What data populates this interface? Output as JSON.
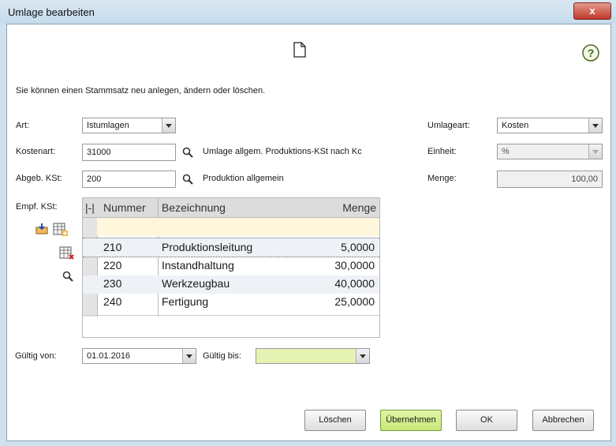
{
  "window": {
    "title": "Umlage bearbeiten",
    "close_glyph": "x"
  },
  "intro_text": "Sie können einen Stammsatz neu anlegen, ändern oder löschen.",
  "icons": {
    "new_record": "document-icon",
    "help": "help-icon"
  },
  "form": {
    "art": {
      "label": "Art:",
      "value": "Istumlagen"
    },
    "kostenart": {
      "label": "Kostenart:",
      "value": "31000",
      "description": "Umlage allgem. Produktions-KSt nach Kc"
    },
    "abgeb_kst": {
      "label": "Abgeb. KSt:",
      "value": "200",
      "description": "Produktion allgemein"
    },
    "empf_kst": {
      "label": "Empf. KSt:"
    },
    "umlageart": {
      "label": "Umlageart:",
      "value": "Kosten"
    },
    "einheit": {
      "label": "Einheit:",
      "value": "%"
    },
    "menge": {
      "label": "Menge:",
      "value": "100,00"
    },
    "gueltig_von": {
      "label": "Gültig von:",
      "value": "01.01.2016"
    },
    "gueltig_bis": {
      "label": "Gültig bis:",
      "value": ""
    }
  },
  "grid": {
    "columns": {
      "marker": "|-|",
      "nummer": "Nummer",
      "bezeichnung": "Bezeichnung",
      "menge": "Menge"
    },
    "rows": [
      {
        "nummer": "210",
        "bezeichnung": "Produktionsleitung",
        "menge": "5,0000"
      },
      {
        "nummer": "220",
        "bezeichnung": "Instandhaltung",
        "menge": "30,0000"
      },
      {
        "nummer": "230",
        "bezeichnung": "Werkzeugbau",
        "menge": "40,0000"
      },
      {
        "nummer": "240",
        "bezeichnung": "Fertigung",
        "menge": "25,0000"
      }
    ]
  },
  "buttons": {
    "delete": "Löschen",
    "apply": "Übernehmen",
    "ok": "OK",
    "cancel": "Abbrechen"
  },
  "colors": {
    "apply_button": "#c7e87a",
    "gueltig_bis_field": "#e6f2b4",
    "new_row": "#fff6dc"
  }
}
